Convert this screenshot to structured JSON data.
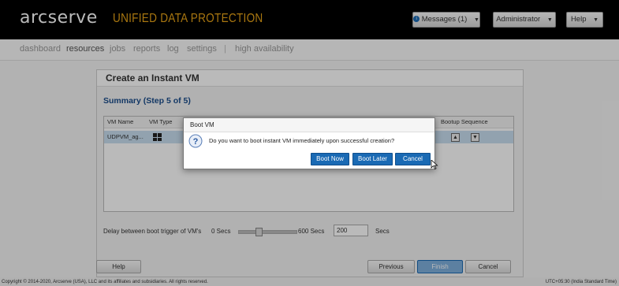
{
  "header": {
    "logo": "arcserve",
    "product": "UNIFIED DATA PROTECTION",
    "messages_label": "Messages (1)",
    "user_label": "Administrator",
    "help_label": "Help",
    "info_icon": "info-circle-icon"
  },
  "nav": {
    "items": [
      "dashboard",
      "resources",
      "jobs",
      "reports",
      "log",
      "settings",
      "high availability"
    ],
    "separator": "|",
    "active": "resources"
  },
  "wizard": {
    "title": "Create an Instant VM",
    "step_title": "Summary (Step 5 of 5)",
    "columns": [
      "VM Name",
      "VM Type",
      "Bootup Sequence"
    ],
    "row": {
      "vm_name": "UDPVM_ag...",
      "vm_type_icon": "windows-icon",
      "bootup_icons": [
        "move-up-icon",
        "move-down-icon"
      ]
    },
    "delay_label": "Delay between boot trigger of VM's",
    "delay_min": "0 Secs",
    "delay_max": "600 Secs",
    "delay_value": "200",
    "delay_unit": "Secs",
    "slider_fraction": 0.33,
    "buttons": {
      "help": "Help",
      "previous": "Previous",
      "finish": "Finish",
      "cancel": "Cancel"
    }
  },
  "dialog": {
    "title": "Boot VM",
    "icon": "question-icon",
    "message": "Do you want to boot instant VM immediately upon successful creation?",
    "buttons": {
      "boot_now": "Boot Now",
      "boot_later": "Boot Later",
      "cancel": "Cancel"
    }
  },
  "status": {
    "copyright": "Copyright © 2014-2020, Arcserve (USA), LLC and its affiliates and subsidiaries. All rights reserved.",
    "timezone": "UTC+05:30 (India Standard Time)"
  },
  "colors": {
    "accent": "#1a6ab4",
    "brand": "#e8a317",
    "header_bg": "#000000",
    "step_title": "#1a4c8b"
  }
}
